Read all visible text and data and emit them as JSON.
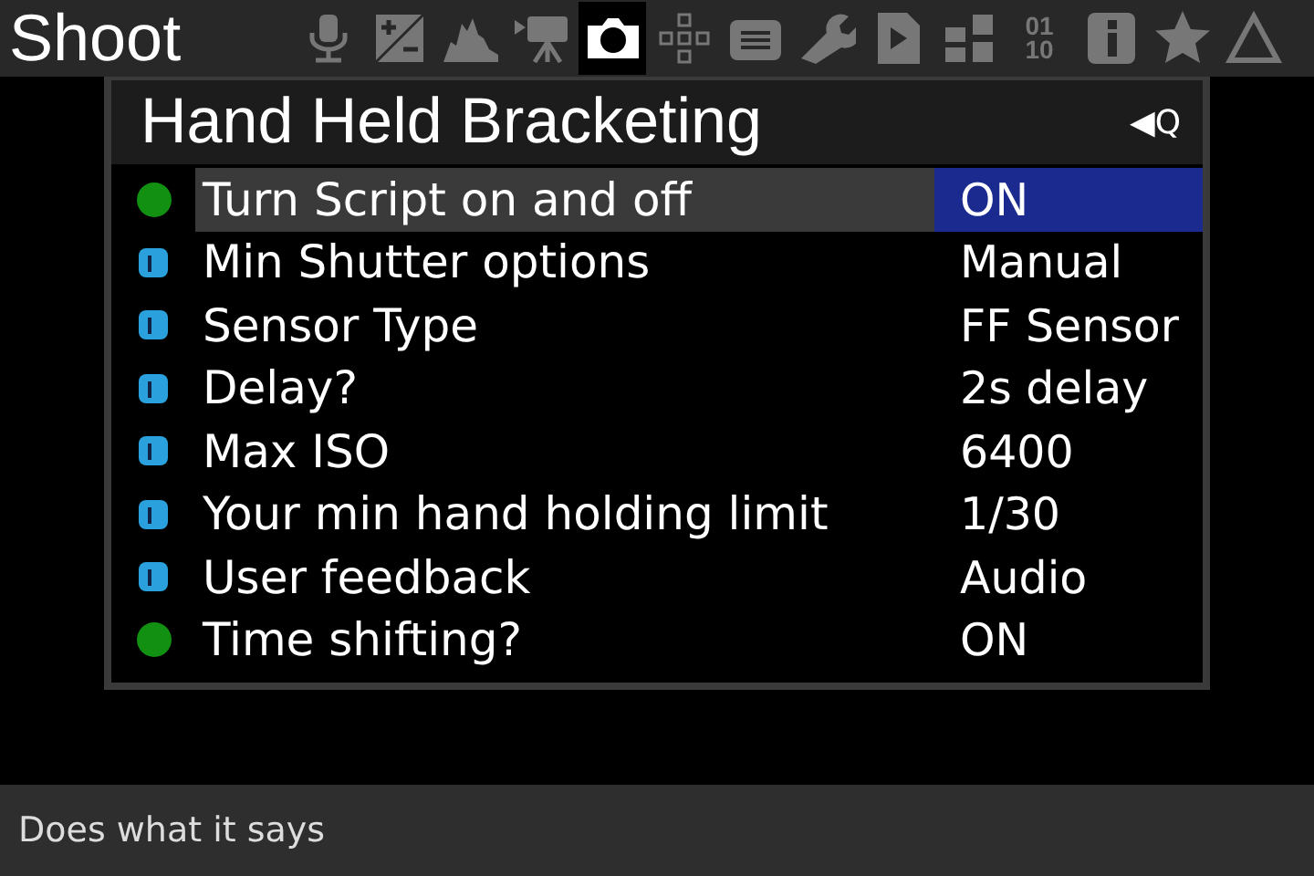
{
  "top_bar": {
    "title": "Shoot",
    "tabs": [
      {
        "kind": "audio",
        "selected": false
      },
      {
        "kind": "exposure",
        "selected": false
      },
      {
        "kind": "histogram",
        "selected": false
      },
      {
        "kind": "movie",
        "selected": false
      },
      {
        "kind": "camera",
        "selected": true
      },
      {
        "kind": "focus",
        "selected": false
      },
      {
        "kind": "display",
        "selected": false
      },
      {
        "kind": "wrench",
        "selected": false
      },
      {
        "kind": "script",
        "selected": false
      },
      {
        "kind": "modules",
        "selected": false
      },
      {
        "kind": "debug",
        "selected": false,
        "label": "01 10"
      },
      {
        "kind": "info",
        "selected": false
      },
      {
        "kind": "star",
        "selected": false
      },
      {
        "kind": "triangle",
        "selected": false
      }
    ]
  },
  "menu": {
    "title": "Hand Held Bracketing",
    "hint": "◀Q",
    "items": [
      {
        "kind": "toggle",
        "label": "Turn Script on and off",
        "value": "ON",
        "selected": true
      },
      {
        "kind": "choice",
        "label": "Min Shutter options",
        "value": "Manual",
        "selected": false
      },
      {
        "kind": "choice",
        "label": "Sensor Type",
        "value": "FF Sensor",
        "selected": false
      },
      {
        "kind": "choice",
        "label": "Delay?",
        "value": "2s delay",
        "selected": false
      },
      {
        "kind": "choice",
        "label": "Max ISO",
        "value": "6400",
        "selected": false
      },
      {
        "kind": "choice",
        "label": "Your min hand holding limit",
        "value": "1/30",
        "selected": false
      },
      {
        "kind": "choice",
        "label": "User feedback",
        "value": "Audio",
        "selected": false
      },
      {
        "kind": "toggle",
        "label": "Time shifting?",
        "value": "ON",
        "selected": false
      }
    ]
  },
  "help_bar": {
    "text": "Does what it says"
  }
}
